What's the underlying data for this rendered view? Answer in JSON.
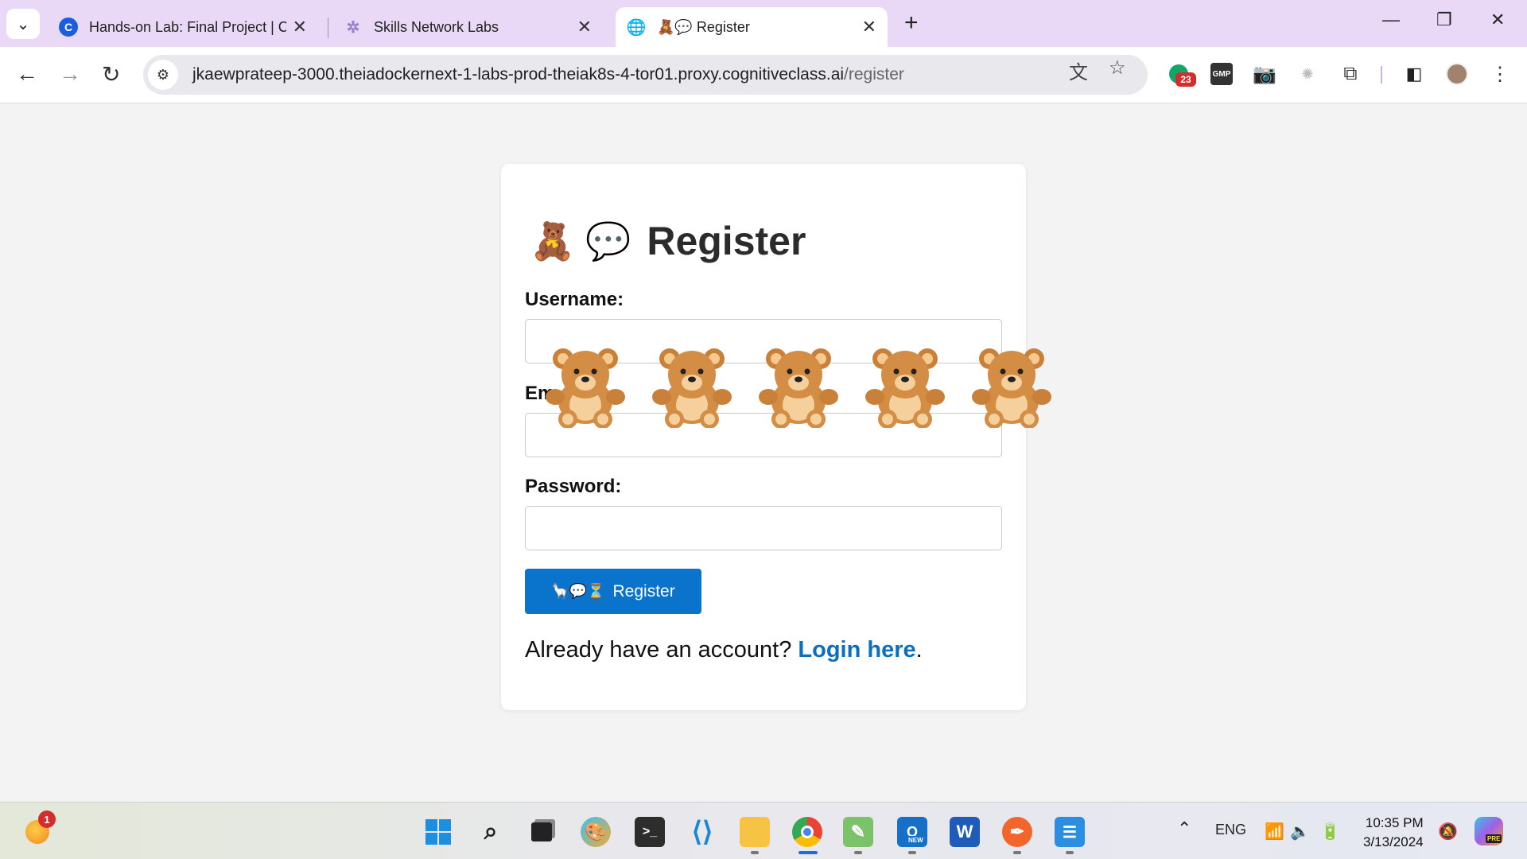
{
  "browser": {
    "tabs": [
      {
        "title": "Hands-on Lab: Final Project | Co",
        "favicon": "C"
      },
      {
        "title": "Skills Network Labs",
        "favicon": "✲"
      },
      {
        "title": "🧸💬 Register",
        "favicon": "🌐"
      }
    ],
    "url_host": "jkaewprateep-3000.theiadockernext-1-labs-prod-theiak8s-4-tor01.proxy.cognitiveclass.ai",
    "url_path": "/register",
    "extension_badge": "23",
    "ext_gmp_label": "GMP"
  },
  "page": {
    "heading_emoji": "🧸 💬",
    "heading": "Register",
    "username_label": "Username:",
    "email_label": "Em",
    "password_label": "Password:",
    "submit_icons": "🦙💬⏳",
    "submit_label": "Register",
    "footer_text": "Already have an account? ",
    "login_link": "Login here",
    "footer_end": ".",
    "bear_count": 5
  },
  "taskbar": {
    "weather_badge": "1",
    "lang": "ENG",
    "time": "10:35 PM",
    "date": "3/13/2024",
    "outlook_badge": "NEW",
    "copilot_badge": "PRE"
  },
  "colors": {
    "accent_button": "#0a73cc",
    "link": "#0a6fc2",
    "tabbar": "#e9d9f7"
  }
}
